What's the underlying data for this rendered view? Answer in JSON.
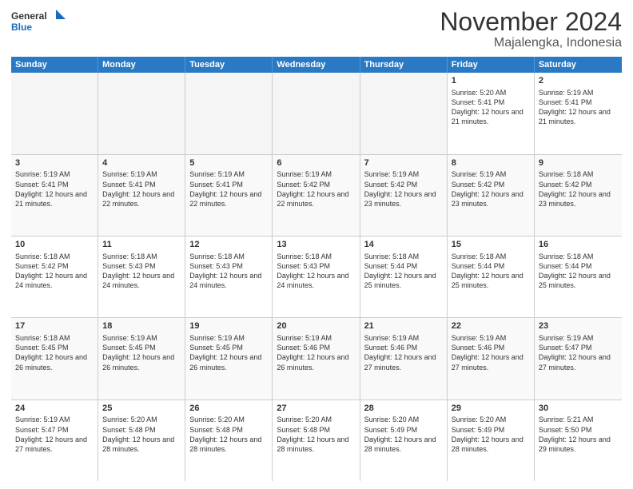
{
  "logo": {
    "line1": "General",
    "line2": "Blue"
  },
  "title": "November 2024",
  "location": "Majalengka, Indonesia",
  "days_of_week": [
    "Sunday",
    "Monday",
    "Tuesday",
    "Wednesday",
    "Thursday",
    "Friday",
    "Saturday"
  ],
  "weeks": [
    [
      {
        "day": "",
        "info": ""
      },
      {
        "day": "",
        "info": ""
      },
      {
        "day": "",
        "info": ""
      },
      {
        "day": "",
        "info": ""
      },
      {
        "day": "",
        "info": ""
      },
      {
        "day": "1",
        "sunrise": "Sunrise: 5:20 AM",
        "sunset": "Sunset: 5:41 PM",
        "daylight": "Daylight: 12 hours and 21 minutes."
      },
      {
        "day": "2",
        "sunrise": "Sunrise: 5:19 AM",
        "sunset": "Sunset: 5:41 PM",
        "daylight": "Daylight: 12 hours and 21 minutes."
      }
    ],
    [
      {
        "day": "3",
        "sunrise": "Sunrise: 5:19 AM",
        "sunset": "Sunset: 5:41 PM",
        "daylight": "Daylight: 12 hours and 21 minutes."
      },
      {
        "day": "4",
        "sunrise": "Sunrise: 5:19 AM",
        "sunset": "Sunset: 5:41 PM",
        "daylight": "Daylight: 12 hours and 22 minutes."
      },
      {
        "day": "5",
        "sunrise": "Sunrise: 5:19 AM",
        "sunset": "Sunset: 5:41 PM",
        "daylight": "Daylight: 12 hours and 22 minutes."
      },
      {
        "day": "6",
        "sunrise": "Sunrise: 5:19 AM",
        "sunset": "Sunset: 5:42 PM",
        "daylight": "Daylight: 12 hours and 22 minutes."
      },
      {
        "day": "7",
        "sunrise": "Sunrise: 5:19 AM",
        "sunset": "Sunset: 5:42 PM",
        "daylight": "Daylight: 12 hours and 23 minutes."
      },
      {
        "day": "8",
        "sunrise": "Sunrise: 5:19 AM",
        "sunset": "Sunset: 5:42 PM",
        "daylight": "Daylight: 12 hours and 23 minutes."
      },
      {
        "day": "9",
        "sunrise": "Sunrise: 5:18 AM",
        "sunset": "Sunset: 5:42 PM",
        "daylight": "Daylight: 12 hours and 23 minutes."
      }
    ],
    [
      {
        "day": "10",
        "sunrise": "Sunrise: 5:18 AM",
        "sunset": "Sunset: 5:42 PM",
        "daylight": "Daylight: 12 hours and 24 minutes."
      },
      {
        "day": "11",
        "sunrise": "Sunrise: 5:18 AM",
        "sunset": "Sunset: 5:43 PM",
        "daylight": "Daylight: 12 hours and 24 minutes."
      },
      {
        "day": "12",
        "sunrise": "Sunrise: 5:18 AM",
        "sunset": "Sunset: 5:43 PM",
        "daylight": "Daylight: 12 hours and 24 minutes."
      },
      {
        "day": "13",
        "sunrise": "Sunrise: 5:18 AM",
        "sunset": "Sunset: 5:43 PM",
        "daylight": "Daylight: 12 hours and 24 minutes."
      },
      {
        "day": "14",
        "sunrise": "Sunrise: 5:18 AM",
        "sunset": "Sunset: 5:44 PM",
        "daylight": "Daylight: 12 hours and 25 minutes."
      },
      {
        "day": "15",
        "sunrise": "Sunrise: 5:18 AM",
        "sunset": "Sunset: 5:44 PM",
        "daylight": "Daylight: 12 hours and 25 minutes."
      },
      {
        "day": "16",
        "sunrise": "Sunrise: 5:18 AM",
        "sunset": "Sunset: 5:44 PM",
        "daylight": "Daylight: 12 hours and 25 minutes."
      }
    ],
    [
      {
        "day": "17",
        "sunrise": "Sunrise: 5:18 AM",
        "sunset": "Sunset: 5:45 PM",
        "daylight": "Daylight: 12 hours and 26 minutes."
      },
      {
        "day": "18",
        "sunrise": "Sunrise: 5:19 AM",
        "sunset": "Sunset: 5:45 PM",
        "daylight": "Daylight: 12 hours and 26 minutes."
      },
      {
        "day": "19",
        "sunrise": "Sunrise: 5:19 AM",
        "sunset": "Sunset: 5:45 PM",
        "daylight": "Daylight: 12 hours and 26 minutes."
      },
      {
        "day": "20",
        "sunrise": "Sunrise: 5:19 AM",
        "sunset": "Sunset: 5:46 PM",
        "daylight": "Daylight: 12 hours and 26 minutes."
      },
      {
        "day": "21",
        "sunrise": "Sunrise: 5:19 AM",
        "sunset": "Sunset: 5:46 PM",
        "daylight": "Daylight: 12 hours and 27 minutes."
      },
      {
        "day": "22",
        "sunrise": "Sunrise: 5:19 AM",
        "sunset": "Sunset: 5:46 PM",
        "daylight": "Daylight: 12 hours and 27 minutes."
      },
      {
        "day": "23",
        "sunrise": "Sunrise: 5:19 AM",
        "sunset": "Sunset: 5:47 PM",
        "daylight": "Daylight: 12 hours and 27 minutes."
      }
    ],
    [
      {
        "day": "24",
        "sunrise": "Sunrise: 5:19 AM",
        "sunset": "Sunset: 5:47 PM",
        "daylight": "Daylight: 12 hours and 27 minutes."
      },
      {
        "day": "25",
        "sunrise": "Sunrise: 5:20 AM",
        "sunset": "Sunset: 5:48 PM",
        "daylight": "Daylight: 12 hours and 28 minutes."
      },
      {
        "day": "26",
        "sunrise": "Sunrise: 5:20 AM",
        "sunset": "Sunset: 5:48 PM",
        "daylight": "Daylight: 12 hours and 28 minutes."
      },
      {
        "day": "27",
        "sunrise": "Sunrise: 5:20 AM",
        "sunset": "Sunset: 5:48 PM",
        "daylight": "Daylight: 12 hours and 28 minutes."
      },
      {
        "day": "28",
        "sunrise": "Sunrise: 5:20 AM",
        "sunset": "Sunset: 5:49 PM",
        "daylight": "Daylight: 12 hours and 28 minutes."
      },
      {
        "day": "29",
        "sunrise": "Sunrise: 5:20 AM",
        "sunset": "Sunset: 5:49 PM",
        "daylight": "Daylight: 12 hours and 28 minutes."
      },
      {
        "day": "30",
        "sunrise": "Sunrise: 5:21 AM",
        "sunset": "Sunset: 5:50 PM",
        "daylight": "Daylight: 12 hours and 29 minutes."
      }
    ]
  ]
}
